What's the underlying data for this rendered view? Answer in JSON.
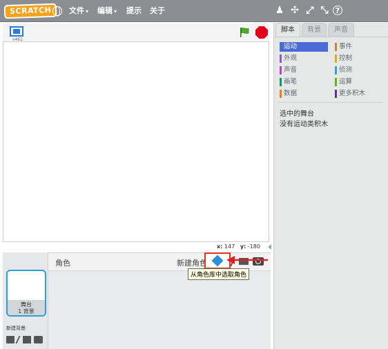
{
  "menubar": {
    "logo": "SCRATCH",
    "menus": [
      {
        "label": "文件",
        "caret": "▾"
      },
      {
        "label": "编辑",
        "caret": "▾"
      },
      {
        "label": "提示"
      },
      {
        "label": "关于"
      }
    ],
    "tools": [
      "duplicate-stamp-icon",
      "delete-cut-icon",
      "grow-icon",
      "shrink-icon",
      "help-icon"
    ],
    "tool_glyphs": [
      "♟",
      "✣",
      "⤢",
      "⤡",
      "?"
    ]
  },
  "stage": {
    "version": "v461",
    "x_label": "x:",
    "x_value": "147",
    "y_label": "y:",
    "y_value": "-180"
  },
  "sprite_pane": {
    "sprites_label": "角色",
    "new_sprite_label": "新建角色:",
    "tooltip": "从角色库中选取角色",
    "stage_thumb_name": "舞台",
    "stage_thumb_count": "1 背景",
    "new_backdrop_label": "新建背景"
  },
  "right_panel": {
    "tabs": [
      "脚本",
      "背景",
      "声音"
    ],
    "categories": [
      {
        "label": "运动",
        "color": "#4a6cd4"
      },
      {
        "label": "事件",
        "color": "#c88330"
      },
      {
        "label": "外观",
        "color": "#8a55d7"
      },
      {
        "label": "控制",
        "color": "#e1a91a"
      },
      {
        "label": "声音",
        "color": "#bb42c3"
      },
      {
        "label": "侦测",
        "color": "#2ca5e2"
      },
      {
        "label": "画笔",
        "color": "#0e9a6c"
      },
      {
        "label": "运算",
        "color": "#5cb712"
      },
      {
        "label": "数据",
        "color": "#ee7d16"
      },
      {
        "label": "更多积木",
        "color": "#632d99"
      }
    ],
    "message_line1": "选中的舞台",
    "message_line2": "没有运动类积木"
  }
}
